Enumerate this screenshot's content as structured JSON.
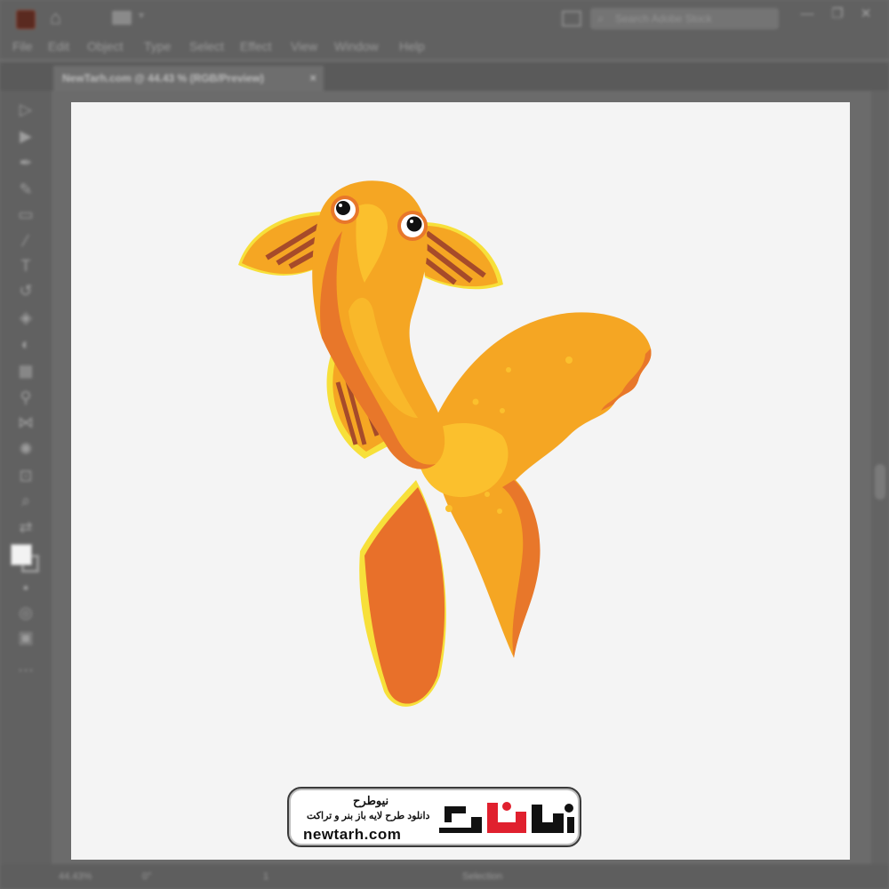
{
  "app": {
    "logo": "Ai",
    "window_controls": [
      "—",
      "❐",
      "✕"
    ]
  },
  "menu": [
    "File",
    "Edit",
    "Object",
    "Type",
    "Select",
    "Effect",
    "View",
    "Window",
    "Help"
  ],
  "document_tab": {
    "title": "NewTarh.com @ 44.43 % (RGB/Preview)",
    "close": "×"
  },
  "search": {
    "placeholder": "Search Adobe Stock"
  },
  "status": {
    "zoom": "44.43%",
    "rotation": "0°",
    "artboard_index": "1",
    "tool": "Selection"
  },
  "watermark": {
    "fa_title": "نیوطرح",
    "fa_sub": "دانلود طرح لایه باز بنر و تراکت",
    "url": "newtarh.com",
    "logo_text": "نیوطرح"
  },
  "colors": {
    "fish_body": "#f5a623",
    "fish_dark": "#e8772a",
    "fish_light": "#fbc02d",
    "fin_brown": "#a64b2a",
    "outline_yellow": "#f7e03a",
    "logo_red": "#e0202e"
  }
}
